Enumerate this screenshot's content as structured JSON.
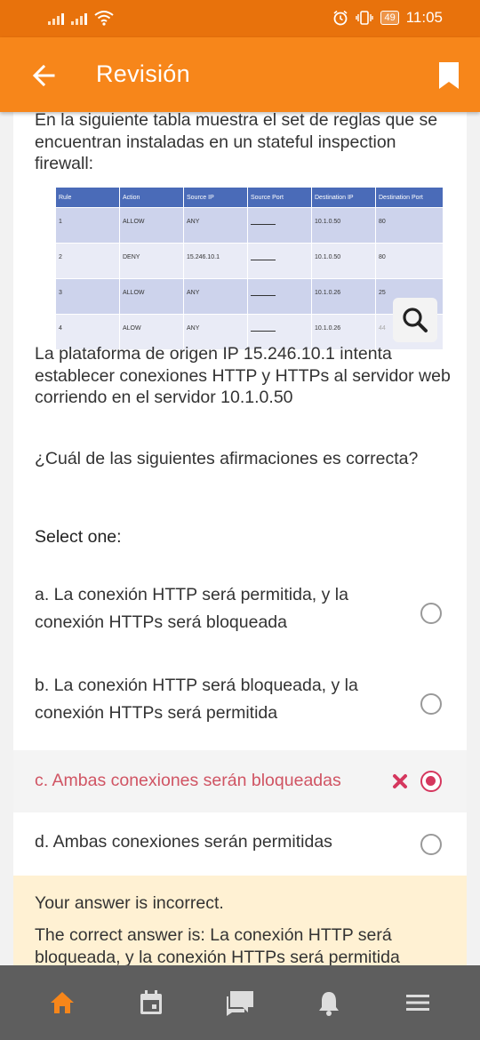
{
  "status_bar": {
    "time": "11:05",
    "battery": "49",
    "icons": [
      "signal-icon",
      "signal-icon",
      "wifi-icon",
      "alarm-icon",
      "vibrate-icon",
      "battery-icon"
    ]
  },
  "app_bar": {
    "title": "Revisión",
    "back_icon": "arrow-left-icon",
    "bookmark_icon": "bookmark-icon"
  },
  "question": {
    "intro": "En la siguiente tabla muestra el set de reglas que se encuentran instaladas en un stateful inspection firewall:",
    "table": {
      "headers": [
        "Rule",
        "Action",
        "Source IP",
        "Source Port",
        "Destination IP",
        "Destination Port"
      ],
      "rows": [
        [
          "1",
          "ALLOW",
          "ANY",
          "",
          "10.1.0.50",
          "80"
        ],
        [
          "2",
          "DENY",
          "15.246.10.1",
          "",
          "10.1.0.50",
          "80"
        ],
        [
          "3",
          "ALLOW",
          "ANY",
          "",
          "10.1.0.26",
          "25"
        ],
        [
          "4",
          "ALOW",
          "ANY",
          "",
          "10.1.0.26",
          "44"
        ]
      ]
    },
    "zoom_icon": "search-icon",
    "scenario": "La plataforma de origen IP 15.246.10.1 intenta establecer conexiones HTTP y HTTPs al servidor web corriendo en el servidor 10.1.0.50",
    "prompt": "¿Cuál de las siguientes afirmaciones es correcta?",
    "select_label": "Select one:",
    "options": [
      {
        "text": "a. La conexión HTTP será permitida, y la conexión HTTPs será bloqueada",
        "selected": false
      },
      {
        "text": "b. La conexión HTTP será bloqueada, y la conexión HTTPs será permitida",
        "selected": false
      },
      {
        "text": "c. Ambas conexiones serán bloqueadas",
        "selected": true,
        "incorrect": true
      },
      {
        "text": "d. Ambas conexiones serán permitidas",
        "selected": false
      }
    ]
  },
  "feedback": {
    "result": "Your answer is incorrect.",
    "correct_answer": "The correct answer is: La conexión HTTP será bloqueada, y la conexión HTTPs será permitida"
  },
  "bottom_nav": {
    "items": [
      "home-icon",
      "calendar-icon",
      "forum-icon",
      "bell-icon",
      "menu-icon"
    ],
    "active": "home-icon"
  },
  "colors": {
    "status_bar": "#e8720c",
    "app_bar": "#f7861a",
    "incorrect": "#d5375e",
    "feedback_bg": "#fff1d3",
    "nav_bg": "#5e5e5e",
    "nav_active": "#f7861a",
    "table_header": "#4a6bb8"
  }
}
